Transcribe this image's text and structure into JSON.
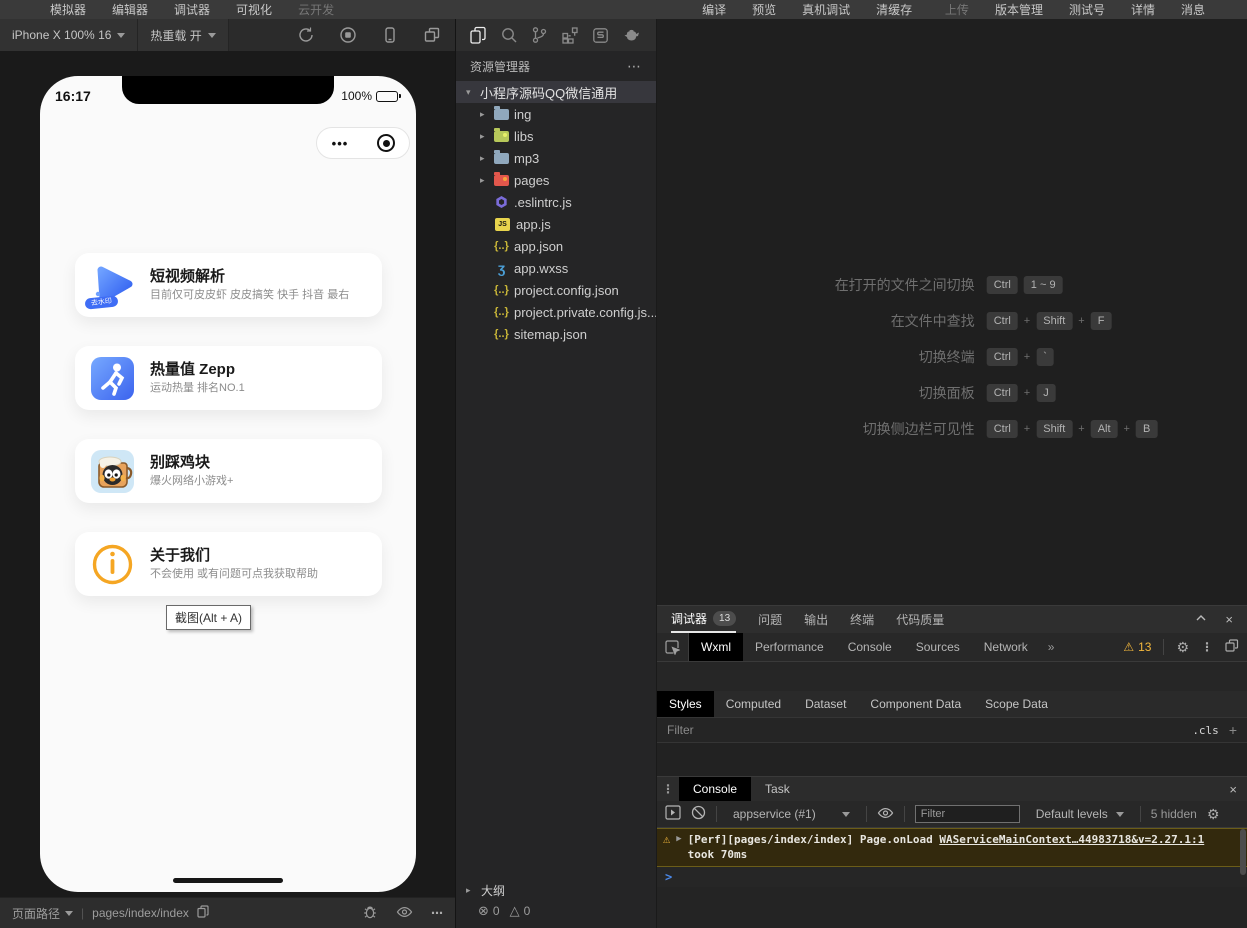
{
  "menu": {
    "left": [
      "模拟器",
      "编辑器",
      "调试器",
      "可视化",
      "云开发"
    ],
    "center": [
      "编译",
      "预览",
      "真机调试",
      "清缓存"
    ],
    "right": [
      "上传",
      "版本管理",
      "测试号",
      "详情",
      "消息"
    ]
  },
  "toolbar": {
    "device": "iPhone X 100% 16",
    "hot_reload": "热重载 开"
  },
  "phone": {
    "time": "16:17",
    "battery_percent": "100%",
    "capsule_dots": "•••",
    "cards": [
      {
        "icon": "video-parse-icon",
        "badge": "去水印",
        "title": "短视频解析",
        "subtitle": "目前仅可皮皮虾 皮皮搞笑 快手 抖音 最右"
      },
      {
        "icon": "zepp-icon",
        "title": "热量值 Zepp",
        "subtitle": "运动热量 排名NO.1"
      },
      {
        "icon": "chicken-game-icon",
        "title": "别踩鸡块",
        "subtitle": "爆火网络小游戏+"
      },
      {
        "icon": "about-icon",
        "title": "关于我们",
        "subtitle": "不会使用 或有问题可点我获取帮助"
      }
    ],
    "tooltip": "截图(Alt + A)"
  },
  "explorer": {
    "title": "资源管理器",
    "more": "⋯",
    "root": "小程序源码QQ微信通用",
    "items": [
      {
        "name": "ing"
      },
      {
        "name": "libs"
      },
      {
        "name": "mp3"
      },
      {
        "name": "pages"
      },
      {
        "name": ".eslintrc.js"
      },
      {
        "name": "app.js"
      },
      {
        "name": "app.json"
      },
      {
        "name": "app.wxss"
      },
      {
        "name": "project.config.json"
      },
      {
        "name": "project.private.config.js..."
      },
      {
        "name": "sitemap.json"
      }
    ],
    "outline": "大纲",
    "error_count": "0",
    "warning_count": "0"
  },
  "editor": {
    "plus": "+",
    "hints": [
      {
        "label": "在打开的文件之间切换",
        "keys": [
          "Ctrl",
          "1 ~ 9"
        ]
      },
      {
        "label": "在文件中查找",
        "keys": [
          "Ctrl",
          "Shift",
          "F"
        ]
      },
      {
        "label": "切换终端",
        "keys": [
          "Ctrl",
          "`"
        ]
      },
      {
        "label": "切换面板",
        "keys": [
          "Ctrl",
          "J"
        ]
      },
      {
        "label": "切换侧边栏可见性",
        "keys": [
          "Ctrl",
          "Shift",
          "Alt",
          "B"
        ]
      }
    ]
  },
  "debugger": {
    "tabs": [
      "调试器",
      "问题",
      "输出",
      "终端",
      "代码质量"
    ],
    "badge": "13",
    "devtools_tabs": [
      "Wxml",
      "Performance",
      "Console",
      "Sources",
      "Network"
    ],
    "overflow": "»",
    "warning_count": "13",
    "styles_tabs": [
      "Styles",
      "Computed",
      "Dataset",
      "Component Data",
      "Scope Data"
    ],
    "styles_filter_placeholder": "Filter",
    "cls_button": ".cls",
    "console_tabs": [
      "Console",
      "Task"
    ],
    "context_selector": "appservice (#1)",
    "console_filter_placeholder": "Filter",
    "levels_selector": "Default levels",
    "hidden_count": "5 hidden",
    "log": {
      "expand": "▶",
      "prefix": "[Perf][pages/index/index] Page.onLoad",
      "link": "WAServiceMainContext…44983718&v=2.27.1:1",
      "line2": "took 70ms"
    }
  },
  "statusbar": {
    "path_label": "页面路径",
    "path": "pages/index/index"
  },
  "colors": {
    "warning_yellow": "#f3b73c",
    "console_warn_bg": "#33290d",
    "prompt_blue": "#4a88e8",
    "accent_blue": "#3f6df5",
    "selection": "#37373d"
  }
}
